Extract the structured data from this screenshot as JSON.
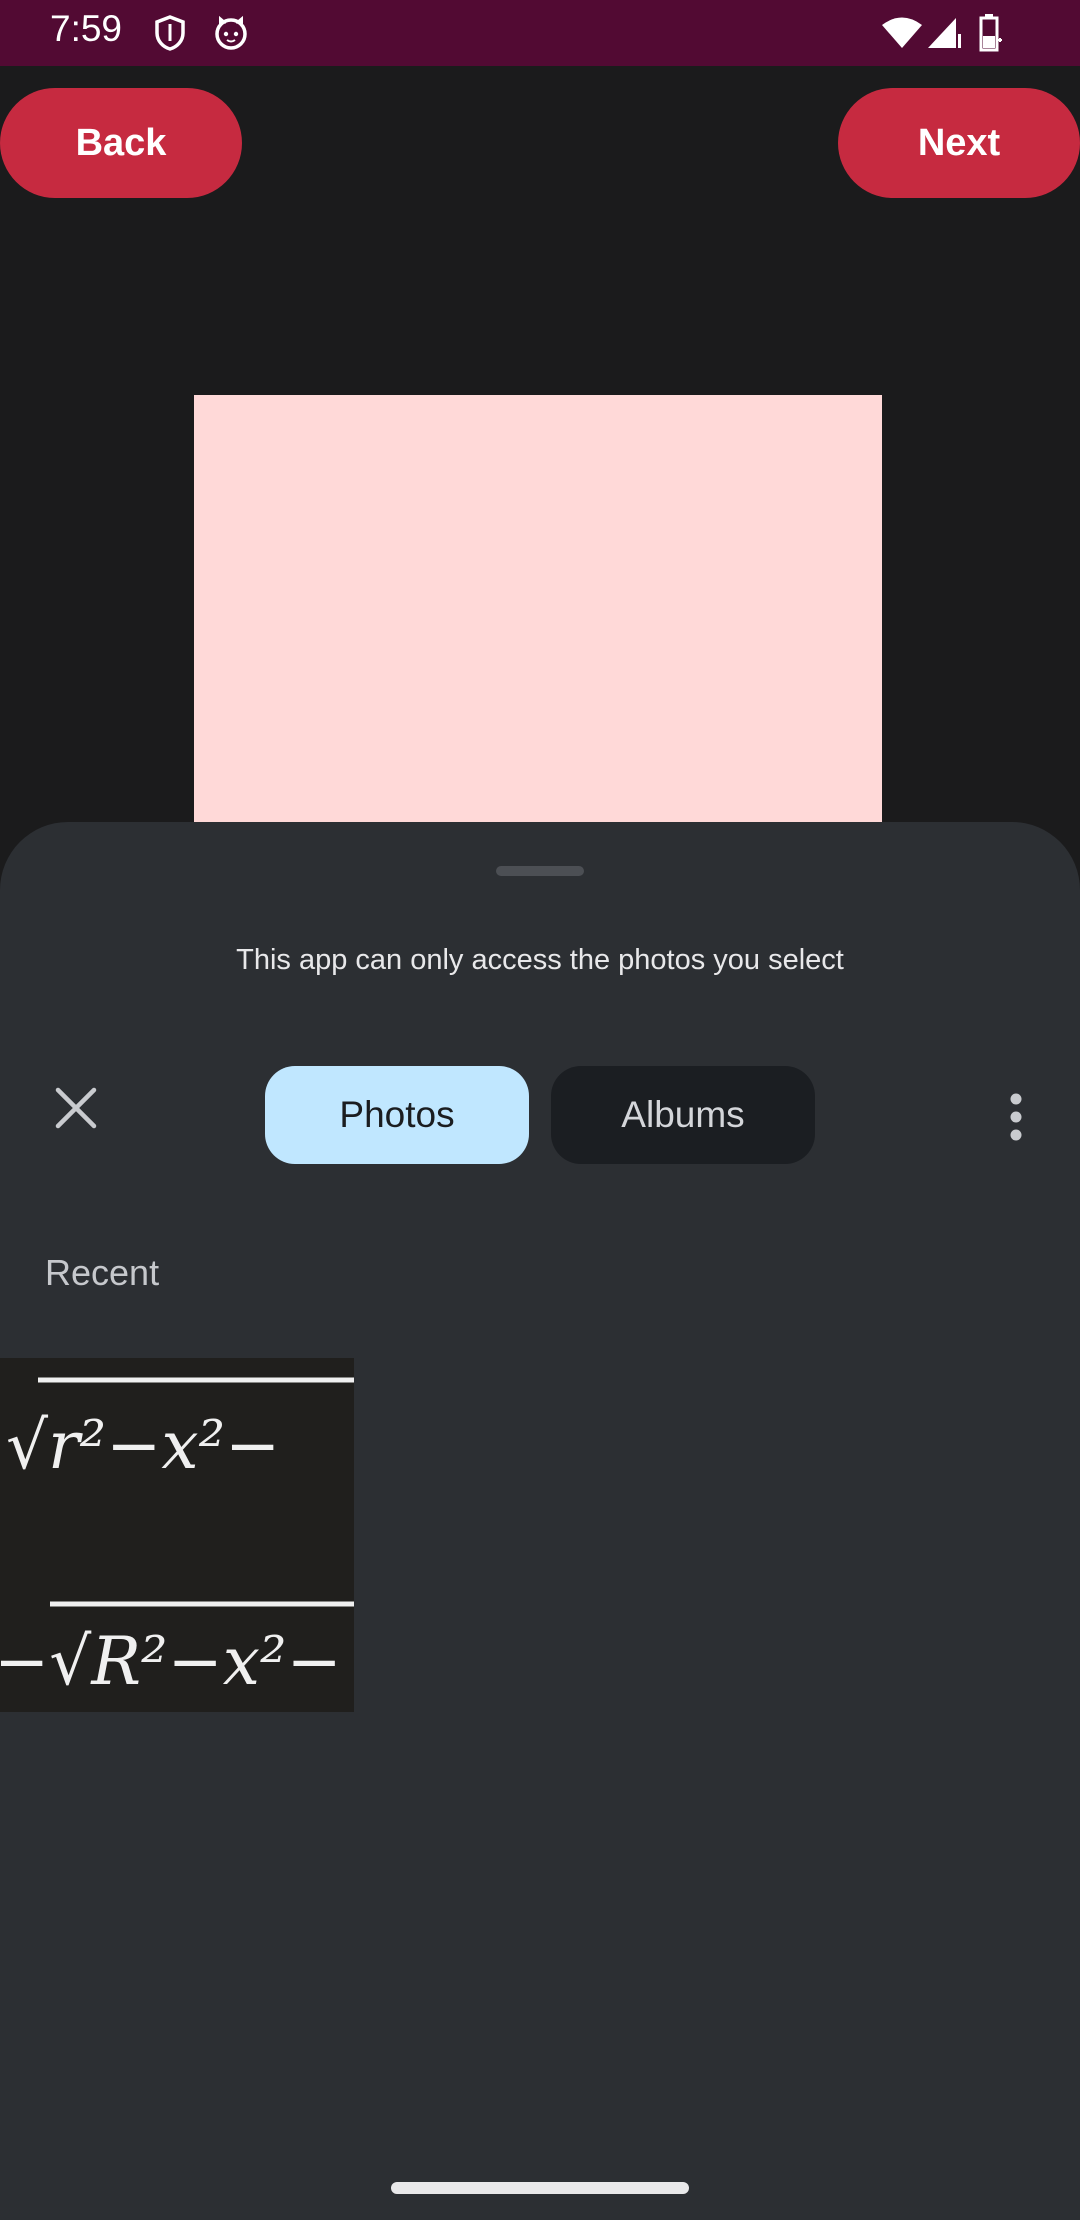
{
  "status_bar": {
    "time": "7:59",
    "background": "#520a33",
    "left_icons": [
      "shield-icon",
      "cat-face-icon"
    ],
    "right_icons": [
      "wifi-icon",
      "cell-signal-icon",
      "battery-icon"
    ]
  },
  "top_buttons": {
    "back_label": "Back",
    "next_label": "Next",
    "color": "#c62a40"
  },
  "preview": {
    "color": "#ffd9d8"
  },
  "sheet": {
    "message": "This app can only access the photos you select",
    "tabs": [
      {
        "label": "Photos",
        "selected": true
      },
      {
        "label": "Albums",
        "selected": false
      }
    ],
    "section_title": "Recent",
    "thumbnails": [
      {
        "formula_top": "√r²−x²−",
        "formula_bottom": "−√R²−x²−"
      }
    ]
  }
}
